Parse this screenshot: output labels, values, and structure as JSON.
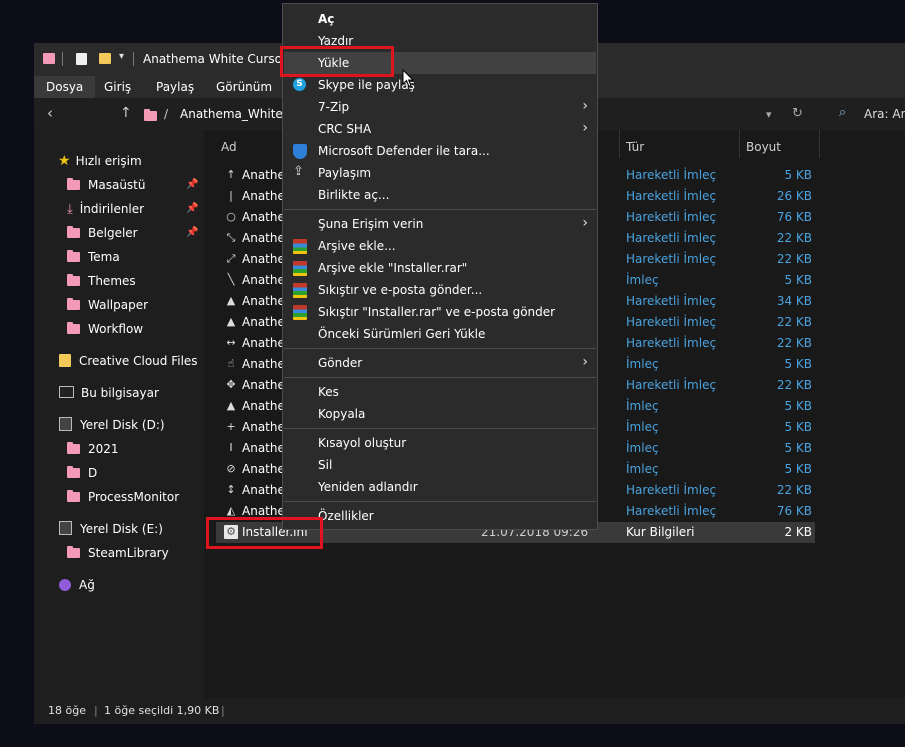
{
  "window": {
    "title": "Anathema White Cursors",
    "ribbon_tabs": [
      "Dosya",
      "Giriş",
      "Paylaş",
      "Görünüm"
    ],
    "address": {
      "path_segments": [
        "Anathema_White_C"
      ],
      "search_label": "Ara: An"
    }
  },
  "sidebar": {
    "quick_access": "Hızlı erişim",
    "pinned": [
      "Masaüstü",
      "İndirilenler",
      "Belgeler"
    ],
    "folders": [
      "Tema",
      "Themes",
      "Wallpaper",
      "Workflow"
    ],
    "creative_cloud": "Creative Cloud Files",
    "this_pc": "Bu bilgisayar",
    "disk_d": "Yerel Disk (D:)",
    "disk_d_children": [
      "2021",
      "D",
      "ProcessMonitor"
    ],
    "disk_e": "Yerel Disk (E:)",
    "disk_e_children": [
      "SteamLibrary"
    ],
    "network": "Ağ"
  },
  "columns": {
    "name": "Ad",
    "type": "Tür",
    "size": "Boyut"
  },
  "files": [
    {
      "name": "Anathe",
      "icon": "↑",
      "type": "Hareketli İmleç",
      "size": "5 KB"
    },
    {
      "name": "Anathe",
      "icon": "|",
      "type": "Hareketli İmleç",
      "size": "26 KB"
    },
    {
      "name": "Anathe",
      "icon": "○",
      "type": "Hareketli İmleç",
      "size": "76 KB"
    },
    {
      "name": "Anathe",
      "icon": "⤡",
      "type": "Hareketli İmleç",
      "size": "22 KB"
    },
    {
      "name": "Anathe",
      "icon": "⤢",
      "type": "Hareketli İmleç",
      "size": "22 KB"
    },
    {
      "name": "Anathe",
      "icon": "╲",
      "type": "İmleç",
      "size": "5 KB"
    },
    {
      "name": "Anathe",
      "icon": "▲",
      "type": "Hareketli İmleç",
      "size": "34 KB"
    },
    {
      "name": "Anathe",
      "icon": "▲",
      "type": "Hareketli İmleç",
      "size": "22 KB"
    },
    {
      "name": "Anathe",
      "icon": "↔",
      "type": "Hareketli İmleç",
      "size": "22 KB"
    },
    {
      "name": "Anathe",
      "icon": "☝",
      "type": "İmleç",
      "size": "5 KB"
    },
    {
      "name": "Anathe",
      "icon": "✥",
      "type": "Hareketli İmleç",
      "size": "22 KB"
    },
    {
      "name": "Anathe",
      "icon": "▲",
      "type": "İmleç",
      "size": "5 KB"
    },
    {
      "name": "Anathe",
      "icon": "+",
      "type": "İmleç",
      "size": "5 KB"
    },
    {
      "name": "Anathe",
      "icon": "I",
      "type": "İmleç",
      "size": "5 KB"
    },
    {
      "name": "Anathe",
      "icon": "⊘",
      "type": "İmleç",
      "size": "5 KB"
    },
    {
      "name": "Anathe",
      "icon": "↕",
      "type": "Hareketli İmleç",
      "size": "22 KB"
    },
    {
      "name": "Anathe",
      "icon": "◭",
      "type": "Hareketli İmleç",
      "size": "76 KB"
    },
    {
      "name": "Installer.inf",
      "icon": "⚙",
      "date": "21.07.2018 09:26",
      "type": "Kur Bilgileri",
      "size": "2 KB",
      "selected": true
    }
  ],
  "status": {
    "count": "18 öğe",
    "selection": "1 öğe seçildi  1,90 KB"
  },
  "context_menu": {
    "items": [
      {
        "label": "Aç",
        "bold": true
      },
      {
        "label": "Yazdır"
      },
      {
        "label": "Yükle",
        "highlight": true
      },
      {
        "label": "Skype ile paylaş",
        "icon": "skype"
      },
      {
        "label": "7-Zip",
        "submenu": true
      },
      {
        "label": "CRC SHA",
        "submenu": true
      },
      {
        "label": "Microsoft Defender ile tara...",
        "icon": "defender"
      },
      {
        "label": "Paylaşım",
        "icon": "share"
      },
      {
        "label": "Birlikte aç..."
      },
      {
        "sep": true
      },
      {
        "label": "Şuna Erişim verin",
        "submenu": true
      },
      {
        "label": "Arşive ekle...",
        "icon": "rar"
      },
      {
        "label": "Arşive ekle \"Installer.rar\"",
        "icon": "rar"
      },
      {
        "label": "Sıkıştır ve e-posta gönder...",
        "icon": "rar"
      },
      {
        "label": "Sıkıştır \"Installer.rar\" ve e-posta gönder",
        "icon": "rar"
      },
      {
        "label": "Önceki Sürümleri Geri Yükle"
      },
      {
        "sep": true
      },
      {
        "label": "Gönder",
        "submenu": true
      },
      {
        "sep": true
      },
      {
        "label": "Kes"
      },
      {
        "label": "Kopyala"
      },
      {
        "sep": true
      },
      {
        "label": "Kısayol oluştur"
      },
      {
        "label": "Sil"
      },
      {
        "label": "Yeniden adlandır"
      },
      {
        "sep": true
      },
      {
        "label": "Özellikler"
      }
    ]
  },
  "colors": {
    "accent_link": "#4aa3df",
    "highlight_box": "#e0141e",
    "folder": "#f39ab6"
  }
}
